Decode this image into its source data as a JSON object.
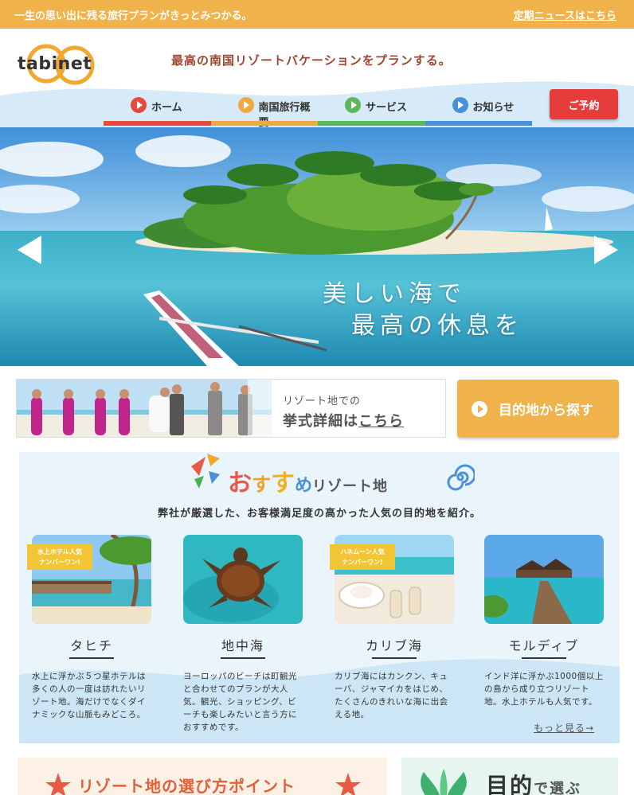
{
  "topbar": {
    "message": "一生の思い出に残る旅行プランがきっとみつかる。",
    "news_link": "定期ニュースはこちら"
  },
  "header": {
    "logo_text": "tabinet",
    "tagline": "最高の南国リゾートバケーションをプランする。",
    "reserve_label": "ご予約"
  },
  "nav": {
    "items": [
      {
        "label": "ホーム",
        "color": "#e64a3c"
      },
      {
        "label": "南国旅行概要",
        "color": "#f0a840"
      },
      {
        "label": "サービス",
        "color": "#5cb85c"
      },
      {
        "label": "お知らせ",
        "color": "#4a90d9"
      }
    ]
  },
  "hero": {
    "line1": "美しい海で",
    "line2": "最高の休息を"
  },
  "wedding": {
    "small": "リゾート地での",
    "big_prefix": "挙式詳細は",
    "big_link": "こちら"
  },
  "destination_button": {
    "label": "目的地から探す"
  },
  "recommend": {
    "title_o": "お",
    "title_su": "す",
    "title_su2": "す",
    "title_me": "め",
    "title_rest": "リゾート地",
    "description": "弊社が厳選した、お客様満足度の高かった人気の目的地を紹介。",
    "more": "もっと見る→",
    "cards": [
      {
        "name": "タヒチ",
        "badge": "水上ホテル人気\nナンバーワン!",
        "text": "水上に浮かぶ５つ星ホテルは多くの人の一度は訪れたいリゾート地。海だけでなくダイナミックな山脈もみどころ。"
      },
      {
        "name": "地中海",
        "badge": "",
        "text": "ヨーロッパのビーチは町観光と合わせてのプランが大人気。観光、ショッピング、ビーチも楽しみたいと言う方におすすめです。"
      },
      {
        "name": "カリブ海",
        "badge": "ハネムーン人気\nナンバーワン!",
        "text": "カリブ海にはカンクン、キューバ、ジャマイカをはじめ、たくさんのきれいな海に出会える地。"
      },
      {
        "name": "モルディブ",
        "badge": "",
        "text": "インド洋に浮かぶ1000個以上の島から成り立つリゾート地。水上ホテルも人気です。"
      }
    ]
  },
  "bottom": {
    "left_title": "リゾート地の選び方ポイント",
    "right_title_big": "目的",
    "right_title_small": "で",
    "right_title_end": "選ぶ"
  }
}
